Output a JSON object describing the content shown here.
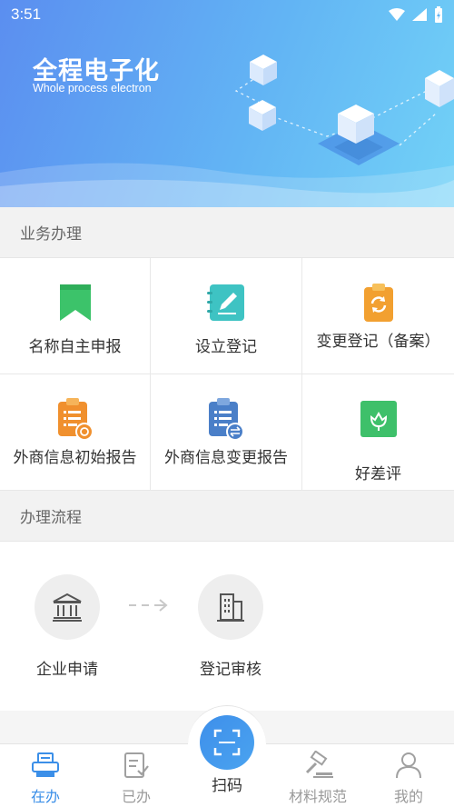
{
  "status_bar": {
    "time": "3:51"
  },
  "banner": {
    "title": "全程电子化",
    "subtitle": "Whole process electron"
  },
  "business_section": {
    "title": "业务办理",
    "items": [
      {
        "label": "名称自主申报",
        "icon": "bookmark-icon",
        "color": "#3cc36a"
      },
      {
        "label": "设立登记",
        "icon": "edit-notebook-icon",
        "color": "#3ec3c3"
      },
      {
        "label": "变更登记（备案）",
        "icon": "clipboard-refresh-icon",
        "color": "#f2a030"
      },
      {
        "label": "外商信息初始报告",
        "icon": "clipboard-clock-icon",
        "color": "#f0902e"
      },
      {
        "label": "外商信息变更报告",
        "icon": "clipboard-exchange-icon",
        "color": "#4a7fc8"
      },
      {
        "label": "好差评",
        "icon": "thumbs-flower-icon",
        "color": "#3ec06a"
      }
    ]
  },
  "process_section": {
    "title": "办理流程",
    "steps": [
      {
        "label": "企业申请",
        "icon": "bank-building-icon"
      },
      {
        "label": "登记审核",
        "icon": "office-building-icon"
      }
    ]
  },
  "bottom_nav": {
    "items": [
      {
        "label": "在办",
        "icon": "printer-tray-icon",
        "active": true
      },
      {
        "label": "已办",
        "icon": "checklist-icon",
        "active": false
      },
      {
        "label": "扫码",
        "icon": "scan-icon",
        "active": false
      },
      {
        "label": "材料规范",
        "icon": "gavel-icon",
        "active": false
      },
      {
        "label": "我的",
        "icon": "user-icon",
        "active": false
      }
    ],
    "active_color": "#3b8fe8"
  }
}
